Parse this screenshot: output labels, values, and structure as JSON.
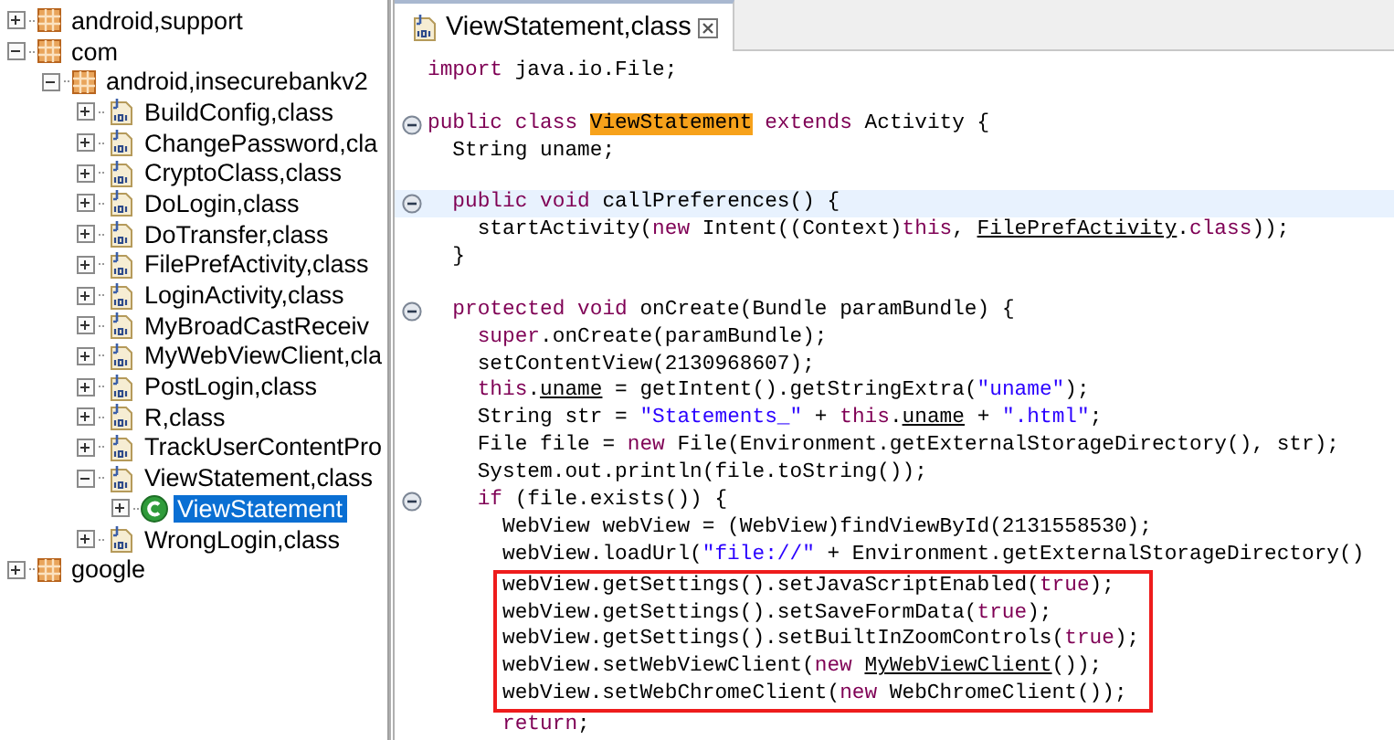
{
  "package_tree": {
    "items": [
      {
        "label": "android,support",
        "kind": "package",
        "expanded": false,
        "selected": false
      },
      {
        "label": "com",
        "kind": "package",
        "expanded": true,
        "selected": false,
        "children": [
          {
            "label": "android,insecurebankv2",
            "kind": "package",
            "expanded": true,
            "selected": false,
            "children": [
              {
                "label": "BuildConfig,class",
                "kind": "classfile",
                "expanded": false,
                "selected": false
              },
              {
                "label": "ChangePassword,cla",
                "kind": "classfile",
                "expanded": false,
                "selected": false
              },
              {
                "label": "CryptoClass,class",
                "kind": "classfile",
                "expanded": false,
                "selected": false
              },
              {
                "label": "DoLogin,class",
                "kind": "classfile",
                "expanded": false,
                "selected": false
              },
              {
                "label": "DoTransfer,class",
                "kind": "classfile",
                "expanded": false,
                "selected": false
              },
              {
                "label": "FilePrefActivity,class",
                "kind": "classfile",
                "expanded": false,
                "selected": false
              },
              {
                "label": "LoginActivity,class",
                "kind": "classfile",
                "expanded": false,
                "selected": false
              },
              {
                "label": "MyBroadCastReceiv",
                "kind": "classfile",
                "expanded": false,
                "selected": false
              },
              {
                "label": "MyWebViewClient,cla",
                "kind": "classfile",
                "expanded": false,
                "selected": false
              },
              {
                "label": "PostLogin,class",
                "kind": "classfile",
                "expanded": false,
                "selected": false
              },
              {
                "label": "R,class",
                "kind": "classfile",
                "expanded": false,
                "selected": false
              },
              {
                "label": "TrackUserContentPro",
                "kind": "classfile",
                "expanded": false,
                "selected": false
              },
              {
                "label": "ViewStatement,class",
                "kind": "classfile",
                "expanded": true,
                "selected": false,
                "children": [
                  {
                    "label": "ViewStatement",
                    "kind": "class",
                    "expanded": false,
                    "selected": true
                  }
                ]
              },
              {
                "label": "WrongLogin,class",
                "kind": "classfile",
                "expanded": false,
                "selected": false
              }
            ]
          }
        ]
      },
      {
        "label": "google",
        "kind": "package",
        "expanded": false,
        "selected": false
      }
    ]
  },
  "editor": {
    "tab": {
      "title": "ViewStatement,class",
      "kind": "classfile",
      "selected": true
    },
    "lines": [
      {
        "kind": "code",
        "current": false,
        "tokens": [
          {
            "kind": "kw",
            "text": "import"
          },
          {
            "kind": "plain",
            "text": " java.io.File;"
          }
        ]
      },
      {
        "kind": "blank"
      },
      {
        "kind": "fold",
        "current": false,
        "tokens": [
          {
            "kind": "kw",
            "text": "public class "
          },
          {
            "kind": "match",
            "text": "ViewStatement"
          },
          {
            "kind": "kw",
            "text": " extends"
          },
          {
            "kind": "plain",
            "text": " Activity {"
          }
        ]
      },
      {
        "kind": "code",
        "current": false,
        "tokens": [
          {
            "kind": "plain",
            "text": "  String uname;"
          }
        ]
      },
      {
        "kind": "blank"
      },
      {
        "kind": "fold",
        "current": true,
        "tokens": [
          {
            "kind": "kw",
            "text": "  public void"
          },
          {
            "kind": "plain",
            "text": " callPreferences() {"
          }
        ]
      },
      {
        "kind": "code",
        "current": false,
        "tokens": [
          {
            "kind": "plain",
            "text": "    startActivity("
          },
          {
            "kind": "kw",
            "text": "new"
          },
          {
            "kind": "plain",
            "text": " Intent((Context)"
          },
          {
            "kind": "kw",
            "text": "this"
          },
          {
            "kind": "plain",
            "text": ", "
          },
          {
            "kind": "link",
            "text": "FilePrefActivity"
          },
          {
            "kind": "plain",
            "text": "."
          },
          {
            "kind": "kw",
            "text": "class"
          },
          {
            "kind": "plain",
            "text": "));"
          }
        ]
      },
      {
        "kind": "code",
        "current": false,
        "tokens": [
          {
            "kind": "plain",
            "text": "  }"
          }
        ]
      },
      {
        "kind": "blank"
      },
      {
        "kind": "fold",
        "current": false,
        "tokens": [
          {
            "kind": "kw",
            "text": "  protected void"
          },
          {
            "kind": "plain",
            "text": " onCreate(Bundle paramBundle) {"
          }
        ]
      },
      {
        "kind": "code",
        "current": false,
        "tokens": [
          {
            "kind": "kw",
            "text": "    super"
          },
          {
            "kind": "plain",
            "text": ".onCreate(paramBundle);"
          }
        ]
      },
      {
        "kind": "code",
        "current": false,
        "tokens": [
          {
            "kind": "plain",
            "text": "    setContentView(2130968607);"
          }
        ]
      },
      {
        "kind": "code",
        "current": false,
        "tokens": [
          {
            "kind": "kw",
            "text": "    this"
          },
          {
            "kind": "plain",
            "text": "."
          },
          {
            "kind": "link",
            "text": "uname"
          },
          {
            "kind": "plain",
            "text": " = getIntent().getStringExtra("
          },
          {
            "kind": "str",
            "text": "\"uname\""
          },
          {
            "kind": "plain",
            "text": ");"
          }
        ]
      },
      {
        "kind": "code",
        "current": false,
        "tokens": [
          {
            "kind": "plain",
            "text": "    String str = "
          },
          {
            "kind": "str",
            "text": "\"Statements_\""
          },
          {
            "kind": "plain",
            "text": " + "
          },
          {
            "kind": "kw",
            "text": "this"
          },
          {
            "kind": "plain",
            "text": "."
          },
          {
            "kind": "link",
            "text": "uname"
          },
          {
            "kind": "plain",
            "text": " + "
          },
          {
            "kind": "str",
            "text": "\".html\""
          },
          {
            "kind": "plain",
            "text": ";"
          }
        ]
      },
      {
        "kind": "code",
        "current": false,
        "tokens": [
          {
            "kind": "plain",
            "text": "    File file = "
          },
          {
            "kind": "kw",
            "text": "new"
          },
          {
            "kind": "plain",
            "text": " File(Environment.getExternalStorageDirectory(), str);"
          }
        ]
      },
      {
        "kind": "code",
        "current": false,
        "tokens": [
          {
            "kind": "plain",
            "text": "    System.out.println(file.toString());"
          }
        ]
      },
      {
        "kind": "fold",
        "current": false,
        "tokens": [
          {
            "kind": "kw",
            "text": "    if"
          },
          {
            "kind": "plain",
            "text": " (file.exists()) {"
          }
        ]
      },
      {
        "kind": "code",
        "current": false,
        "tokens": [
          {
            "kind": "plain",
            "text": "      WebView webView = (WebView)findViewById(2131558530);"
          }
        ]
      },
      {
        "kind": "code",
        "current": false,
        "tokens": [
          {
            "kind": "plain",
            "text": "      webView.loadUrl("
          },
          {
            "kind": "str",
            "text": "\"file://\""
          },
          {
            "kind": "plain",
            "text": " + Environment.getExternalStorageDirectory()"
          }
        ]
      },
      {
        "kind": "box",
        "lines": [
          {
            "kind": "code",
            "current": false,
            "tokens": [
              {
                "kind": "plain",
                "text": "      webView.getSettings().setJavaScriptEnabled("
              },
              {
                "kind": "kw",
                "text": "true"
              },
              {
                "kind": "plain",
                "text": ");"
              }
            ]
          },
          {
            "kind": "code",
            "current": false,
            "tokens": [
              {
                "kind": "plain",
                "text": "      webView.getSettings().setSaveFormData("
              },
              {
                "kind": "kw",
                "text": "true"
              },
              {
                "kind": "plain",
                "text": ");"
              }
            ]
          },
          {
            "kind": "code",
            "current": false,
            "tokens": [
              {
                "kind": "plain",
                "text": "      webView.getSettings().setBuiltInZoomControls("
              },
              {
                "kind": "kw",
                "text": "true"
              },
              {
                "kind": "plain",
                "text": ");"
              }
            ]
          },
          {
            "kind": "code",
            "current": false,
            "tokens": [
              {
                "kind": "plain",
                "text": "      webView.setWebViewClient("
              },
              {
                "kind": "kw",
                "text": "new "
              },
              {
                "kind": "link",
                "text": "MyWebViewClient"
              },
              {
                "kind": "plain",
                "text": "());"
              }
            ]
          },
          {
            "kind": "code",
            "current": false,
            "tokens": [
              {
                "kind": "plain",
                "text": "      webView.setWebChromeClient("
              },
              {
                "kind": "kw",
                "text": "new"
              },
              {
                "kind": "plain",
                "text": " WebChromeClient());"
              }
            ]
          }
        ]
      },
      {
        "kind": "code",
        "current": false,
        "tokens": [
          {
            "kind": "kw",
            "text": "      return"
          },
          {
            "kind": "plain",
            "text": ";"
          }
        ]
      }
    ]
  }
}
